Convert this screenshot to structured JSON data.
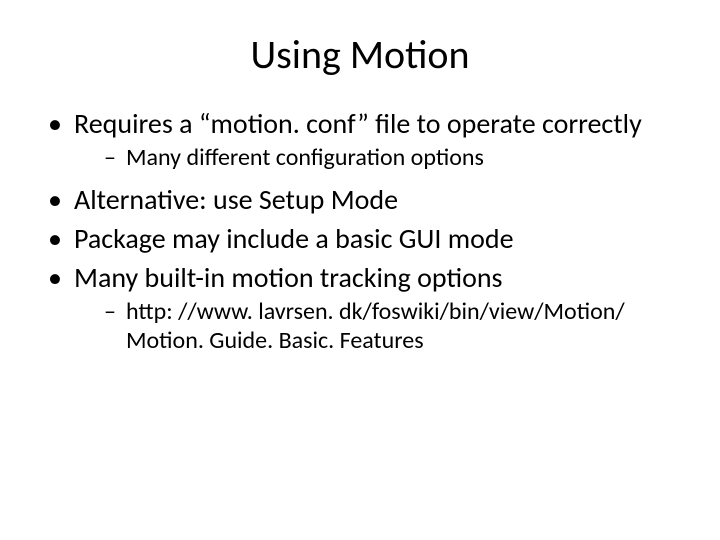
{
  "title": "Using Motion",
  "bullets": {
    "b1": "Requires a “motion. conf” file to operate correctly",
    "b1_sub1": "Many different configuration options",
    "b2": "Alternative: use Setup Mode",
    "b3": "Package may include a basic GUI mode",
    "b4": "Many built-in motion tracking options",
    "b4_sub1": "http: //www. lavrsen. dk/foswiki/bin/view/Motion/ Motion. Guide. Basic. Features"
  }
}
